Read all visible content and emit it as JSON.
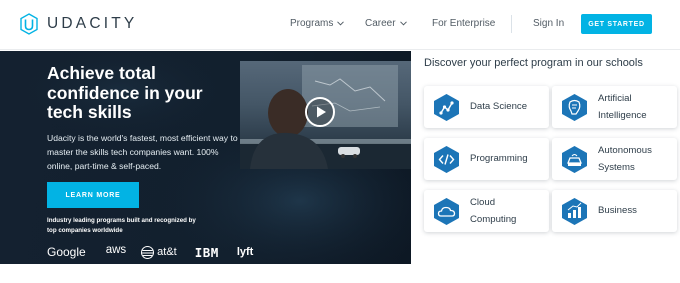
{
  "header": {
    "logo_text": "UDACITY",
    "nav": [
      {
        "label": "Programs",
        "has_dropdown": true
      },
      {
        "label": "Career",
        "has_dropdown": true
      },
      {
        "label": "For Enterprise",
        "has_dropdown": false
      }
    ],
    "sign_in": "Sign In",
    "get_started": "GET STARTED"
  },
  "hero": {
    "title": "Achieve total confidence in your tech skills",
    "description": "Udacity is the world's fastest, most efficient way to master the skills tech companies want. 100% online, part-time & self-paced.",
    "learn_more": "LEARN MORE",
    "industry_text": "Industry leading programs built and recognized by top companies worldwide",
    "partners": [
      "Google",
      "aws",
      "at&t",
      "IBM",
      "lyft"
    ]
  },
  "schools": {
    "title": "Discover your perfect program in our schools",
    "items": [
      {
        "label": "Data Science",
        "icon": "data-science-icon"
      },
      {
        "label": "Artificial\nIntelligence",
        "icon": "ai-icon"
      },
      {
        "label": "Programming",
        "icon": "programming-icon"
      },
      {
        "label": "Autonomous\nSystems",
        "icon": "autonomous-icon"
      },
      {
        "label": "Cloud\nComputing",
        "icon": "cloud-icon"
      },
      {
        "label": "Business",
        "icon": "business-icon"
      }
    ]
  },
  "colors": {
    "accent": "#02b3e4",
    "hero_bg": "#142130",
    "hex_icon": "#1c75b7",
    "text_dark": "#2e3d49"
  }
}
